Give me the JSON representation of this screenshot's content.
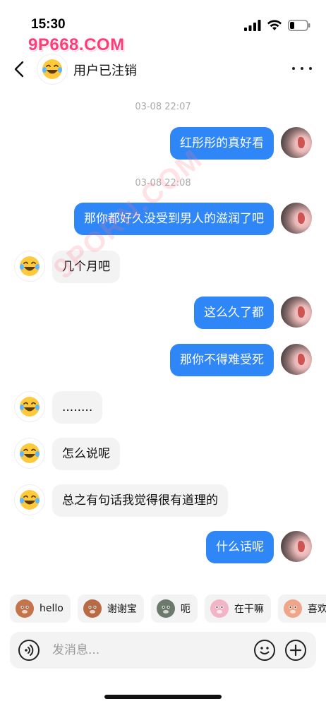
{
  "status_bar": {
    "time": "15:30",
    "battery": 0.2
  },
  "watermark": {
    "logo": "9P668.COM",
    "overlay": "9PORN.COM"
  },
  "header": {
    "title": "用户已注销",
    "back_icon": "chevron-left-icon",
    "more_icon": "more-horizontal-icon"
  },
  "messages": [
    {
      "type": "timestamp",
      "text": "03-08 22:07"
    },
    {
      "type": "message",
      "side": "out",
      "text": "红彤彤的真好看"
    },
    {
      "type": "timestamp",
      "text": "03-08 22:08"
    },
    {
      "type": "message",
      "side": "out",
      "text": "那你都好久没受到男人的滋润了吧"
    },
    {
      "type": "message",
      "side": "in",
      "text": "几个月吧"
    },
    {
      "type": "message",
      "side": "out",
      "text": "这么久了都"
    },
    {
      "type": "message",
      "side": "out",
      "text": "那你不得难受死"
    },
    {
      "type": "message",
      "side": "in",
      "text": "........"
    },
    {
      "type": "message",
      "side": "in",
      "text": "怎么说呢"
    },
    {
      "type": "message",
      "side": "in",
      "text": "总之有句话我觉得很有道理的"
    },
    {
      "type": "message",
      "side": "out",
      "text": "什么话呢"
    }
  ],
  "quick_replies": [
    {
      "label": "hello",
      "icon": "monkey-emoji-icon",
      "color": "#c4744a"
    },
    {
      "label": "谢谢宝",
      "icon": "monkey-flower-emoji-icon",
      "color": "#b86a44"
    },
    {
      "label": "呃",
      "icon": "cat-emoji-icon",
      "color": "#6b7a6a"
    },
    {
      "label": "在干嘛",
      "icon": "rabbit-emoji-icon",
      "color": "#f2b5c6"
    },
    {
      "label": "喜欢",
      "icon": "bunny-emoji-icon",
      "color": "#f0a58a"
    }
  ],
  "input": {
    "placeholder": "发消息...",
    "value": ""
  },
  "colors": {
    "outgoing_bubble": "#2f86f6",
    "incoming_bubble": "#f3f3f3",
    "watermark": "#ff3b78"
  }
}
